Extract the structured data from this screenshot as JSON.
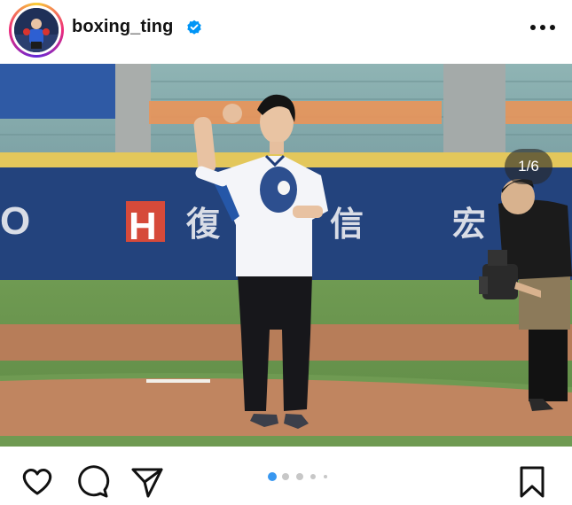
{
  "post": {
    "username": "boxing_ting",
    "verified": true,
    "counter": "1/6",
    "current_slide": 1,
    "total_slides": 6
  },
  "signage": {
    "left": "O",
    "brand_letter": "H",
    "brand_text": "復",
    "mid_text": "信",
    "right_text": "宏"
  },
  "icons": {
    "more": "more-options-icon",
    "verified": "verified-badge-icon",
    "like": "heart-icon",
    "comment": "comment-bubble-icon",
    "share": "send-paper-plane-icon",
    "save": "bookmark-icon"
  },
  "colors": {
    "dot_active": "#3897f0",
    "dot_inactive": "#c7c7c7",
    "verified": "#0095f6"
  }
}
